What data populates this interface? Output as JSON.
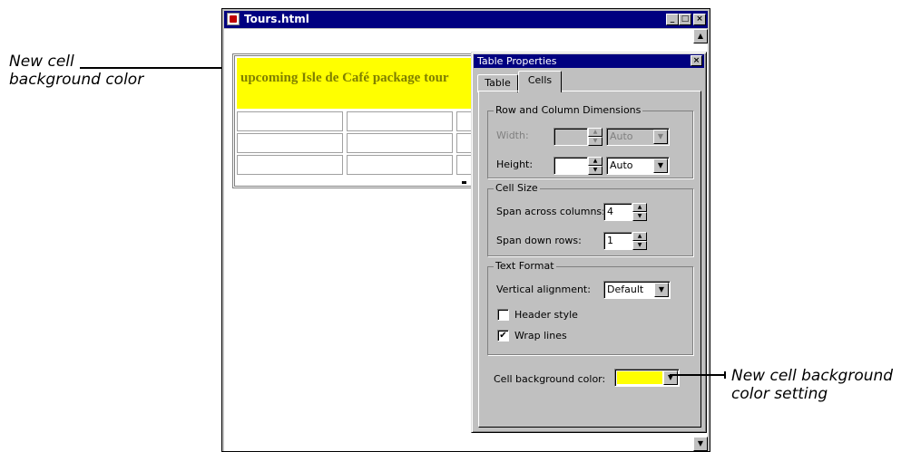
{
  "callouts": {
    "left": [
      "New cell",
      "background color"
    ],
    "right": [
      "New cell background",
      "color setting"
    ]
  },
  "document_window": {
    "title": "Tours.html",
    "controls": {
      "minimize": "_",
      "maximize": "□",
      "close": "×"
    },
    "table": {
      "header_text": "upcoming Isle de Café package tour",
      "header_background": "#ffff00",
      "empty_rows": 3
    }
  },
  "dialog": {
    "title": "Table Properties",
    "tabs": [
      {
        "label": "Table",
        "active": false
      },
      {
        "label": "Cells",
        "active": true
      }
    ],
    "row_column_dimensions": {
      "group_label": "Row and Column Dimensions",
      "width": {
        "label": "Width:",
        "value": "",
        "unit": "Auto",
        "enabled": false
      },
      "height": {
        "label": "Height:",
        "value": "",
        "unit": "Auto",
        "enabled": true
      }
    },
    "cell_size": {
      "group_label": "Cell Size",
      "span_columns": {
        "label": "Span across columns:",
        "value": "4"
      },
      "span_rows": {
        "label": "Span down rows:",
        "value": "1"
      }
    },
    "text_format": {
      "group_label": "Text Format",
      "vertical_alignment": {
        "label": "Vertical alignment:",
        "value": "Default"
      },
      "header_style": {
        "label": "Header style",
        "checked": false
      },
      "wrap_lines": {
        "label": "Wrap lines",
        "checked": true,
        "check_glyph": "✔"
      }
    },
    "cell_background_color": {
      "label": "Cell background color:",
      "color": "#ffff00"
    }
  },
  "colors": {
    "title_bar": "#000080",
    "window_face": "#c0c0c0",
    "highlight_yellow": "#ffff00"
  }
}
